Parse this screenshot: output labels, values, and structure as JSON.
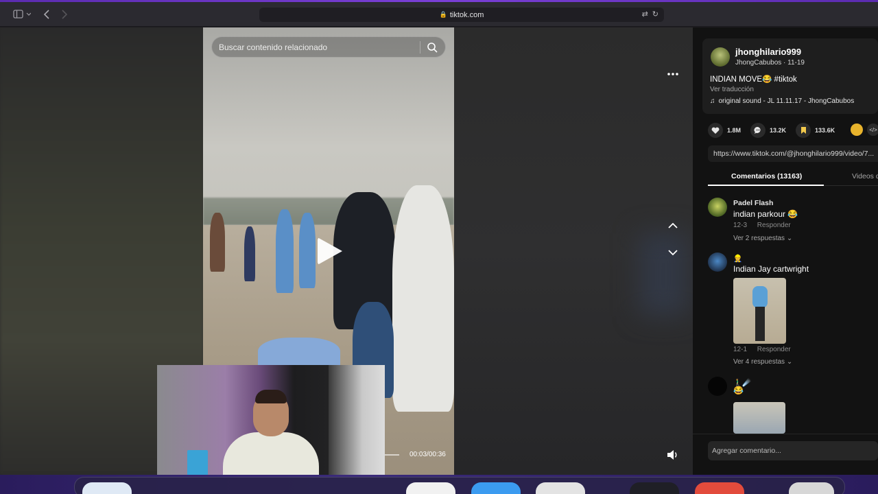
{
  "browser": {
    "url": "tiktok.com",
    "sidebar_icon": "sidebar-icon",
    "back_icon": "chevron-left-icon",
    "forward_icon": "chevron-right-icon",
    "translate_icon": "translate-icon",
    "reload_icon": "reload-icon"
  },
  "video": {
    "search_placeholder": "Buscar contenido relacionado",
    "time": "00:03/00:36",
    "progress": 0.083
  },
  "post": {
    "username": "jhonghilario999",
    "nickname_date": "JhongCabubos · 11-19",
    "description": "INDIAN MOVE😂 #tiktok",
    "translate": "Ver traducción",
    "sound": "original sound - JL 11.11.17 - JhongCabubos",
    "likes": "1.8M",
    "comments": "13.2K",
    "saves": "133.6K",
    "link": "https://www.tiktok.com/@jhonghilario999/video/7..."
  },
  "tabs": {
    "comments": "Comentarios (13163)",
    "videos": "Videos d"
  },
  "comments": [
    {
      "name": "Padel Flash",
      "text": "indian parkour 😂",
      "date": "12-3",
      "reply": "Responder",
      "more": "Ver 2 respuestas ⌄"
    },
    {
      "name": "👷",
      "text": "Indian Jay cartwright",
      "date": "12-1",
      "reply": "Responder",
      "more": "Ver 4 respuestas ⌄"
    },
    {
      "name": "🚶‍♂️☄️",
      "text": "😂"
    }
  ],
  "add_comment": "Agregar comentario...",
  "colors": {
    "panel_bg": "#121212",
    "card_bg": "#1e1e1e",
    "dock": "#3a2a7a"
  }
}
